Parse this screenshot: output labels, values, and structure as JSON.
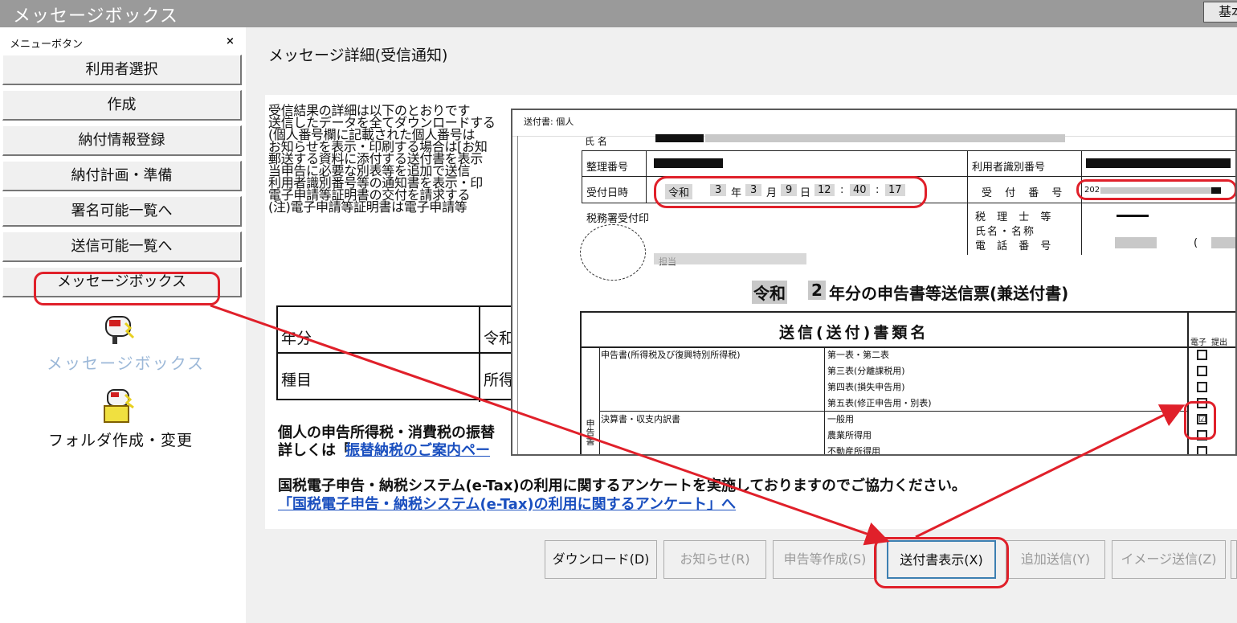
{
  "app": {
    "title": "メッセージボックス",
    "basic_button": "基本"
  },
  "sidebar": {
    "header": "メニューボタン",
    "close": "×",
    "items": [
      {
        "label": "利用者選択"
      },
      {
        "label": "作成"
      },
      {
        "label": "納付情報登録"
      },
      {
        "label": "納付計画・準備"
      },
      {
        "label": "署名可能一覧へ"
      },
      {
        "label": "送信可能一覧へ"
      },
      {
        "label": "メッセージボックス"
      }
    ],
    "icons": [
      {
        "label": "メッセージボックス"
      },
      {
        "label": "フォルダ作成・変更"
      }
    ]
  },
  "main": {
    "title": "メッセージ詳細(受信通知)",
    "body_lines": [
      "受信結果の詳細は以下のとおりです",
      "送信したデータを全てダウンロードする",
      "(個人番号欄に記載された個人番号は",
      "お知らせを表示・印刷する場合は[お知",
      "郵送する資料に添付する送付書を表示",
      "当申告に必要な別表等を追加で送信",
      "利用者識別番号等の通知書を表示・印",
      "電子申請等証明書の交付を請求する",
      "(注)電子申請等証明書は電子申請等"
    ],
    "table": {
      "rows": [
        {
          "key": "年分",
          "value": "令和"
        },
        {
          "key": "種目",
          "value": "所得"
        }
      ]
    },
    "notice1_line1": "個人の申告所得税・消費税の振替",
    "notice1_line2_prefix": "詳しくは「",
    "notice1_link": "振替納税のご案内ペー",
    "notice2": "国税電子申告・納税システム(e-Tax)の利用に関するアンケートを実施しておりますのでご協力ください。",
    "notice2_link": "「国税電子申告・納税システム(e-Tax)の利用に関するアンケート」へ"
  },
  "popup": {
    "title": "送付書: 個人",
    "field_name": "氏  名",
    "field_seiri": "整理番号",
    "field_user_id": "利用者識別番号",
    "field_received": "受付日時",
    "received": {
      "era": "令和",
      "year": "3",
      "year_unit": "年",
      "month": "3",
      "month_unit": "月",
      "day": "9",
      "day_unit": "日",
      "hour": "12",
      "sep1": ":",
      "minute": "40",
      "sep2": ":",
      "second": "17"
    },
    "field_receipt_no": "受 付 番 号",
    "receipt_no_prefix": "202",
    "tax_office_stamp": "税務署受付印",
    "tax_accountant": [
      "税 理 士 等",
      "氏名・名称",
      "電 話 番 号"
    ],
    "paren": "(",
    "stamp_text": "担当",
    "heading_era": "令和",
    "heading_year": "2",
    "heading_rest": "年分の申告書等送信票(兼送付書)",
    "docs_header": "送信(送付)書類名",
    "col_electronic": "電子",
    "col_submit": "提出",
    "group_label": "申告書",
    "section1": "申告書(所得税及び復興特別所得税)",
    "section1_items": [
      "第一表・第二表",
      "第三表(分離課税用)",
      "第四表(損失申告用)",
      "第五表(修正申告用・別表)"
    ],
    "section2": "決算書・収支内訳書",
    "section2_items": [
      "一般用",
      "農業所得用",
      "不動産所得用"
    ],
    "checked_item_index": 4,
    "check_mark": "☑"
  },
  "buttons": [
    {
      "label": "ダウンロード(D)",
      "enabled": true
    },
    {
      "label": "お知らせ(R)",
      "enabled": false
    },
    {
      "label": "申告等作成(S)",
      "enabled": false
    },
    {
      "label": "送付書表示(X)",
      "enabled": true
    },
    {
      "label": "追加送信(Y)",
      "enabled": false
    },
    {
      "label": "イメージ送信(Z)",
      "enabled": false
    }
  ],
  "colors": {
    "highlight": "#e0202a",
    "link": "#1a4fbf",
    "titlebar": "#9a9a9a"
  }
}
